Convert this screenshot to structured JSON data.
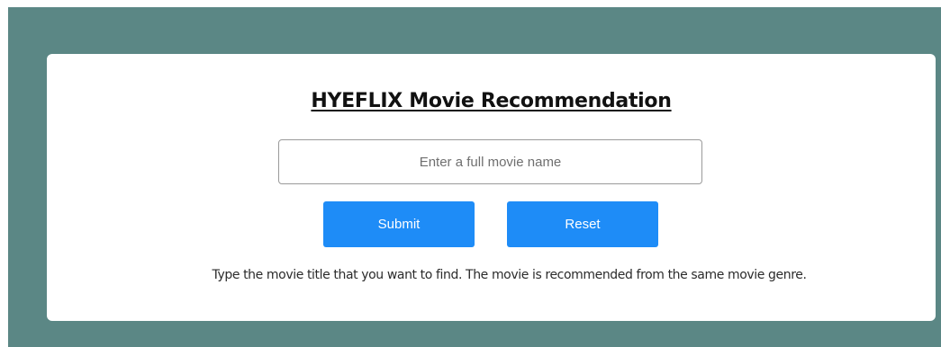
{
  "app": {
    "title": "HYEFLIX Movie Recommendation"
  },
  "search": {
    "value": "",
    "placeholder": "Enter a full movie name"
  },
  "buttons": {
    "submit_label": "Submit",
    "reset_label": "Reset"
  },
  "help": {
    "text": "Type the movie title that you want to find. The movie is recommended from the same movie genre."
  },
  "colors": {
    "page_background": "#5b8785",
    "card_background": "#ffffff",
    "button_background": "#1e8cf7",
    "button_text": "#ffffff"
  }
}
